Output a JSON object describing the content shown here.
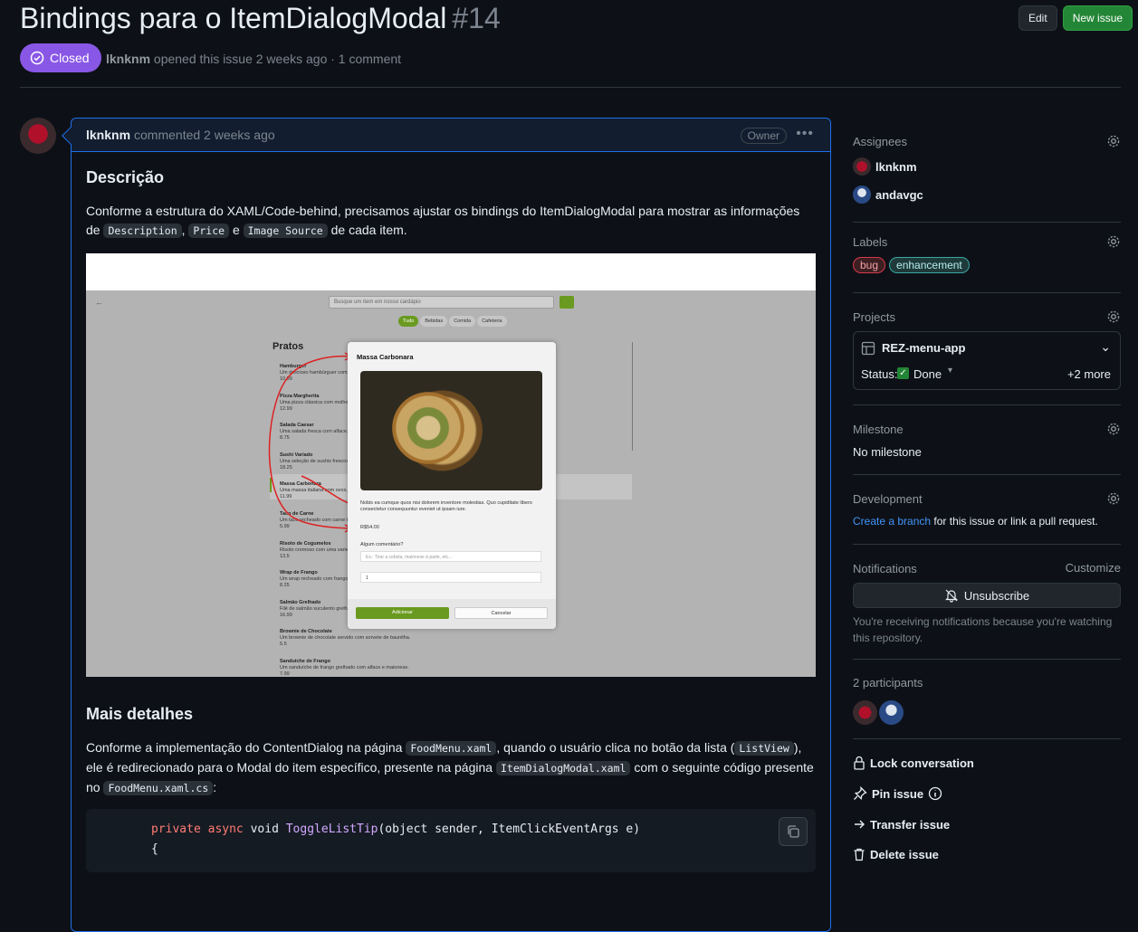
{
  "issue": {
    "title": "Bindings para o ItemDialogModal",
    "number": "#14",
    "state": "Closed",
    "author": "lknknm",
    "meta_text": "opened this issue 2 weeks ago · 1 comment"
  },
  "header_actions": {
    "edit": "Edit",
    "new_issue": "New issue"
  },
  "comment": {
    "author": "lknknm",
    "time": "commented 2 weeks ago",
    "role_badge": "Owner",
    "heading1": "Descrição",
    "para1_a": "Conforme a estrutura do XAML/Code-behind, precisamos ajustar os bindings do ItemDialogModal para mostrar as informações de",
    "code_description": "Description",
    "code_price": "Price",
    "code_image": "Image Source",
    "sep_comma": ",",
    "sep_e": "e",
    "para1_end": "de cada item.",
    "heading2": "Mais detalhes",
    "para2_a": "Conforme a implementação do ContentDialog na página",
    "code_foodmenu": "FoodMenu.xaml",
    "para2_b": ", quando o usuário clica no botão da lista (",
    "code_listview": "ListView",
    "para2_c": "), ele é redirecionado para o Modal do item específico, presente na página",
    "code_itemdialog": "ItemDialogModal.xaml",
    "para2_d": "com o seguinte código presente no",
    "code_foodmenu_cs": "FoodMenu.xaml.cs",
    "para2_end": ":",
    "code_line1_kw1": "private",
    "code_line1_kw2": "async",
    "code_line1_void": "void",
    "code_line1_fn": "ToggleListTip",
    "code_line1_rest": "(object sender, ItemClickEventArgs e)",
    "code_line2": "{"
  },
  "screenshot": {
    "search_placeholder": "Busque um item em nosso cardápio",
    "tabs": [
      "Tudo",
      "Bebidas",
      "Comida",
      "Cafeteria"
    ],
    "section": "Pratos",
    "items": [
      {
        "name": "Hamburger",
        "desc": "Um delicioso hambúrguer com queijo...",
        "price": "10.99"
      },
      {
        "name": "Pizza Margherita",
        "desc": "Uma pizza clássica com molho de...",
        "price": "12.99"
      },
      {
        "name": "Salada Caesar",
        "desc": "Uma salada fresca com alface, frango...",
        "price": "8.75"
      },
      {
        "name": "Sushi Variado",
        "desc": "Uma seleção de sushis frescos e sashimi...",
        "price": "18.25"
      },
      {
        "name": "Massa Carbonara",
        "desc": "Uma massa italiana com ovos, queijo...",
        "price": "11.99"
      },
      {
        "name": "Taco de Carne",
        "desc": "Um taco recheado com carne temperada...",
        "price": "5.99"
      },
      {
        "name": "Risoto de Cogumelos",
        "desc": "Risoto cremoso com uma variedade...",
        "price": "13.5"
      },
      {
        "name": "Wrap de Frango",
        "desc": "Um wrap recheado com frango grelhado...",
        "price": "8.25"
      },
      {
        "name": "Salmão Grelhado",
        "desc": "Filé de salmão suculento grelhado...",
        "price": "16.99"
      },
      {
        "name": "Brownie de Chocolate",
        "desc": "Um brownie de chocolate servido com sorvete de baunilha.",
        "price": "5.5"
      },
      {
        "name": "Sanduíche de Frango",
        "desc": "Um sanduíche de frango grelhado com alface e maionese.",
        "price": "7.99"
      }
    ],
    "modal": {
      "title": "Massa Carbonara",
      "description": "Nobis ea cumque quos nisi dolorem inventore molestias. Quo cupiditate libero consectetur consequuntur eveniet ut ipsam iure.",
      "price": "R$54.00",
      "comment_label": "Algum comentário?",
      "comment_placeholder": "Ex.: Tirar a cebola, maionese à parte, etc...",
      "quantity": "1",
      "add": "Adicionar",
      "cancel": "Cancelar"
    }
  },
  "sidebar": {
    "assignees_title": "Assignees",
    "assignees": [
      "lknknm",
      "andavgc"
    ],
    "labels_title": "Labels",
    "labels": [
      {
        "name": "bug",
        "bg": "#3d1f22",
        "border": "#d73a4a",
        "color": "#f0a0a8"
      },
      {
        "name": "enhancement",
        "bg": "#1f3a3a",
        "border": "#3aa6a6",
        "color": "#b5ecec"
      }
    ],
    "projects_title": "Projects",
    "project_name": "REZ-menu-app",
    "status_label": "Status:",
    "status_value": "Done",
    "more": "+2 more",
    "milestone_title": "Milestone",
    "milestone_value": "No milestone",
    "development_title": "Development",
    "dev_link": "Create a branch",
    "dev_text": "for this issue or link a pull request.",
    "notifications_title": "Notifications",
    "customize": "Customize",
    "unsubscribe": "Unsubscribe",
    "notif_reason": "You're receiving notifications because you're watching this repository.",
    "participants_title": "2 participants",
    "lock": "Lock conversation",
    "pin": "Pin issue",
    "transfer": "Transfer issue",
    "delete": "Delete issue"
  },
  "colors": {
    "accent_blue": "#1f6feb",
    "closed_purple": "#8957e5",
    "green": "#238636",
    "link": "#4493f8"
  }
}
